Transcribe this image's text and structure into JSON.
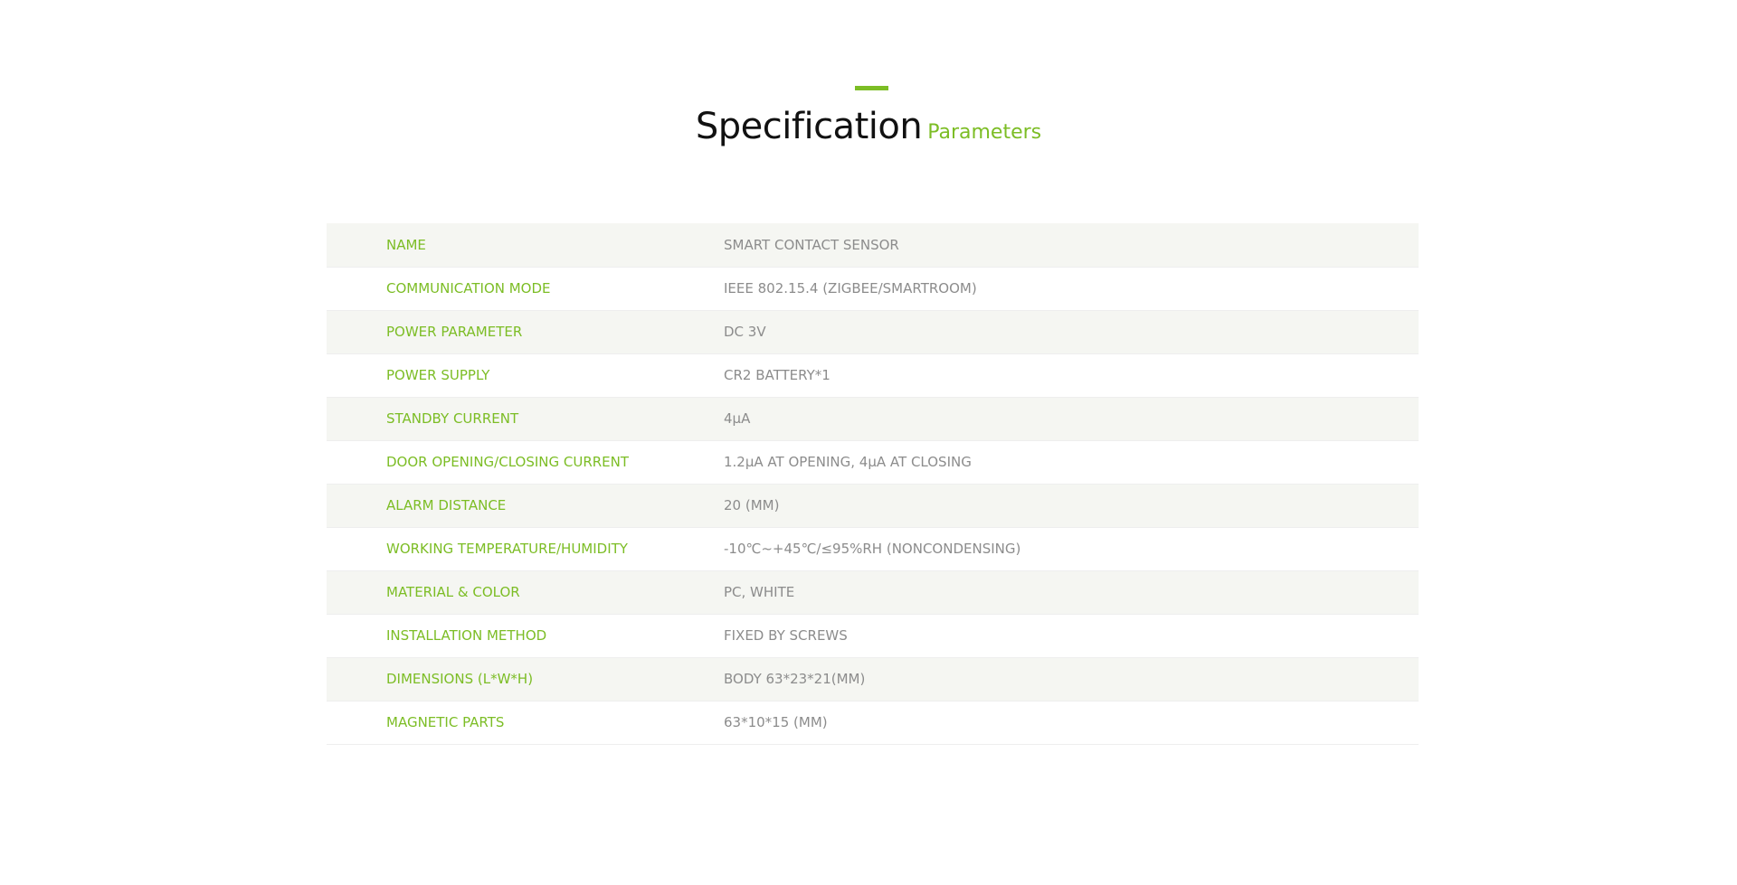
{
  "heading": {
    "title": "Specification",
    "subtitle": "Parameters"
  },
  "colors": {
    "accent": "#7cbd25",
    "value_text": "#8c8c8c",
    "stripe": "#f5f6f2"
  },
  "specs": [
    {
      "label": "NAME",
      "value": "SMART CONTACT SENSOR"
    },
    {
      "label": "COMMUNICATION MODE",
      "value": "IEEE 802.15.4 (ZIGBEE/SMARTROOM)"
    },
    {
      "label": "POWER PARAMETER",
      "value": "DC 3V"
    },
    {
      "label": "POWER SUPPLY",
      "value": "CR2 BATTERY*1"
    },
    {
      "label": "STANDBY CURRENT",
      "value": "4μA"
    },
    {
      "label": "DOOR OPENING/CLOSING CURRENT",
      "value": "1.2μA AT OPENING, 4μA AT CLOSING"
    },
    {
      "label": "ALARM DISTANCE",
      "value": "20 (MM)"
    },
    {
      "label": "WORKING TEMPERATURE/HUMIDITY",
      "value": "-10℃~+45℃/≤95%RH (NONCONDENSING)"
    },
    {
      "label": "MATERIAL & COLOR",
      "value": "PC, WHITE"
    },
    {
      "label": "INSTALLATION METHOD",
      "value": "FIXED BY SCREWS"
    },
    {
      "label": "DIMENSIONS (L*W*H)",
      "value": "BODY 63*23*21(MM)"
    },
    {
      "label": "MAGNETIC PARTS",
      "value": "63*10*15 (MM)"
    }
  ]
}
